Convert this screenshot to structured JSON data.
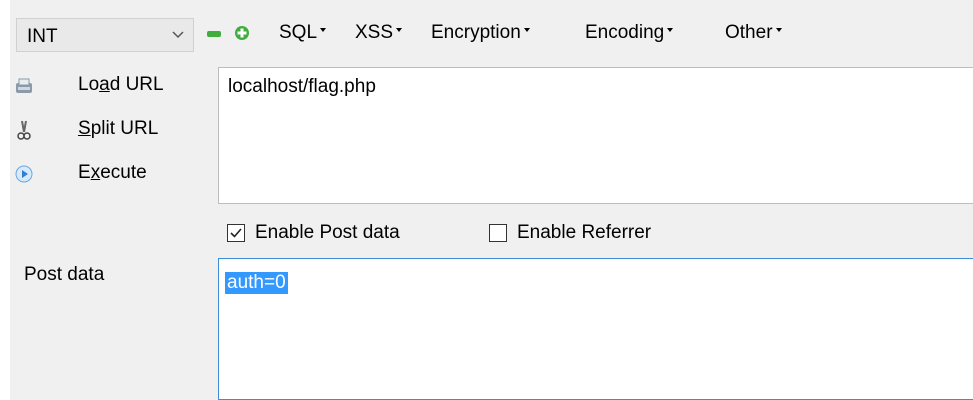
{
  "toolbar": {
    "select_value": "INT",
    "menus": [
      "SQL",
      "XSS",
      "Encryption",
      "Encoding",
      "Other"
    ]
  },
  "actions": [
    {
      "pre": "Lo",
      "accel": "a",
      "post": "d URL",
      "icon": "load-url-icon"
    },
    {
      "pre": "",
      "accel": "S",
      "post": "plit URL",
      "icon": "scissors-icon"
    },
    {
      "pre": "E",
      "accel": "x",
      "post": "ecute",
      "icon": "play-icon"
    }
  ],
  "url": {
    "value": "localhost/flag.php"
  },
  "options": {
    "enable_post_data": {
      "label": "Enable Post data",
      "checked": true
    },
    "enable_referrer": {
      "label": "Enable Referrer",
      "checked": false
    }
  },
  "post": {
    "label": "Post data",
    "value": "auth=0"
  },
  "colors": {
    "panel": "#f0f0f0",
    "selection": "#3399ff",
    "focus_border": "#3c8fd6",
    "green": "#3fae3f"
  }
}
